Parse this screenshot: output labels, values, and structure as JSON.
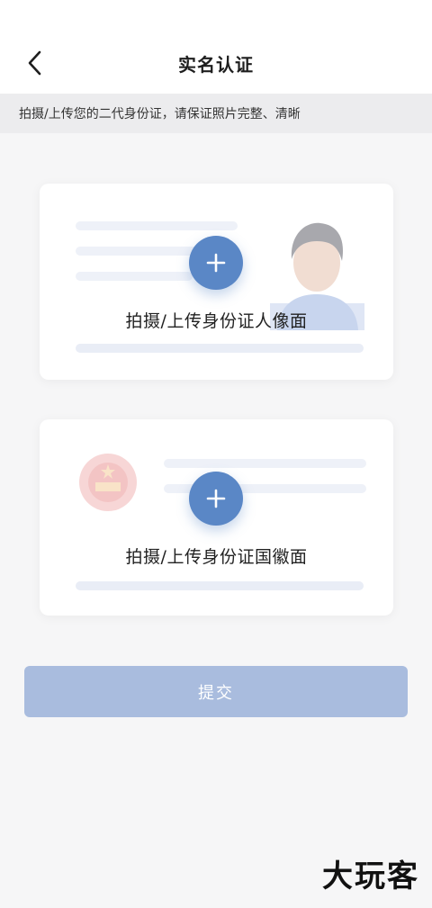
{
  "header": {
    "title": "实名认证",
    "back_icon": "chevron-left-icon"
  },
  "notice": {
    "text": "拍摄/上传您的二代身份证，请保证照片完整、清晰"
  },
  "cards": {
    "front": {
      "label": "拍摄/上传身份证人像面",
      "icon": "plus-icon"
    },
    "back": {
      "label": "拍摄/上传身份证国徽面",
      "icon": "plus-icon"
    }
  },
  "submit": {
    "label": "提交"
  },
  "watermark": {
    "text": "大玩客"
  },
  "colors": {
    "accent": "#5a87c6",
    "submit_disabled": "#a9bcde",
    "background": "#f6f6f7"
  }
}
